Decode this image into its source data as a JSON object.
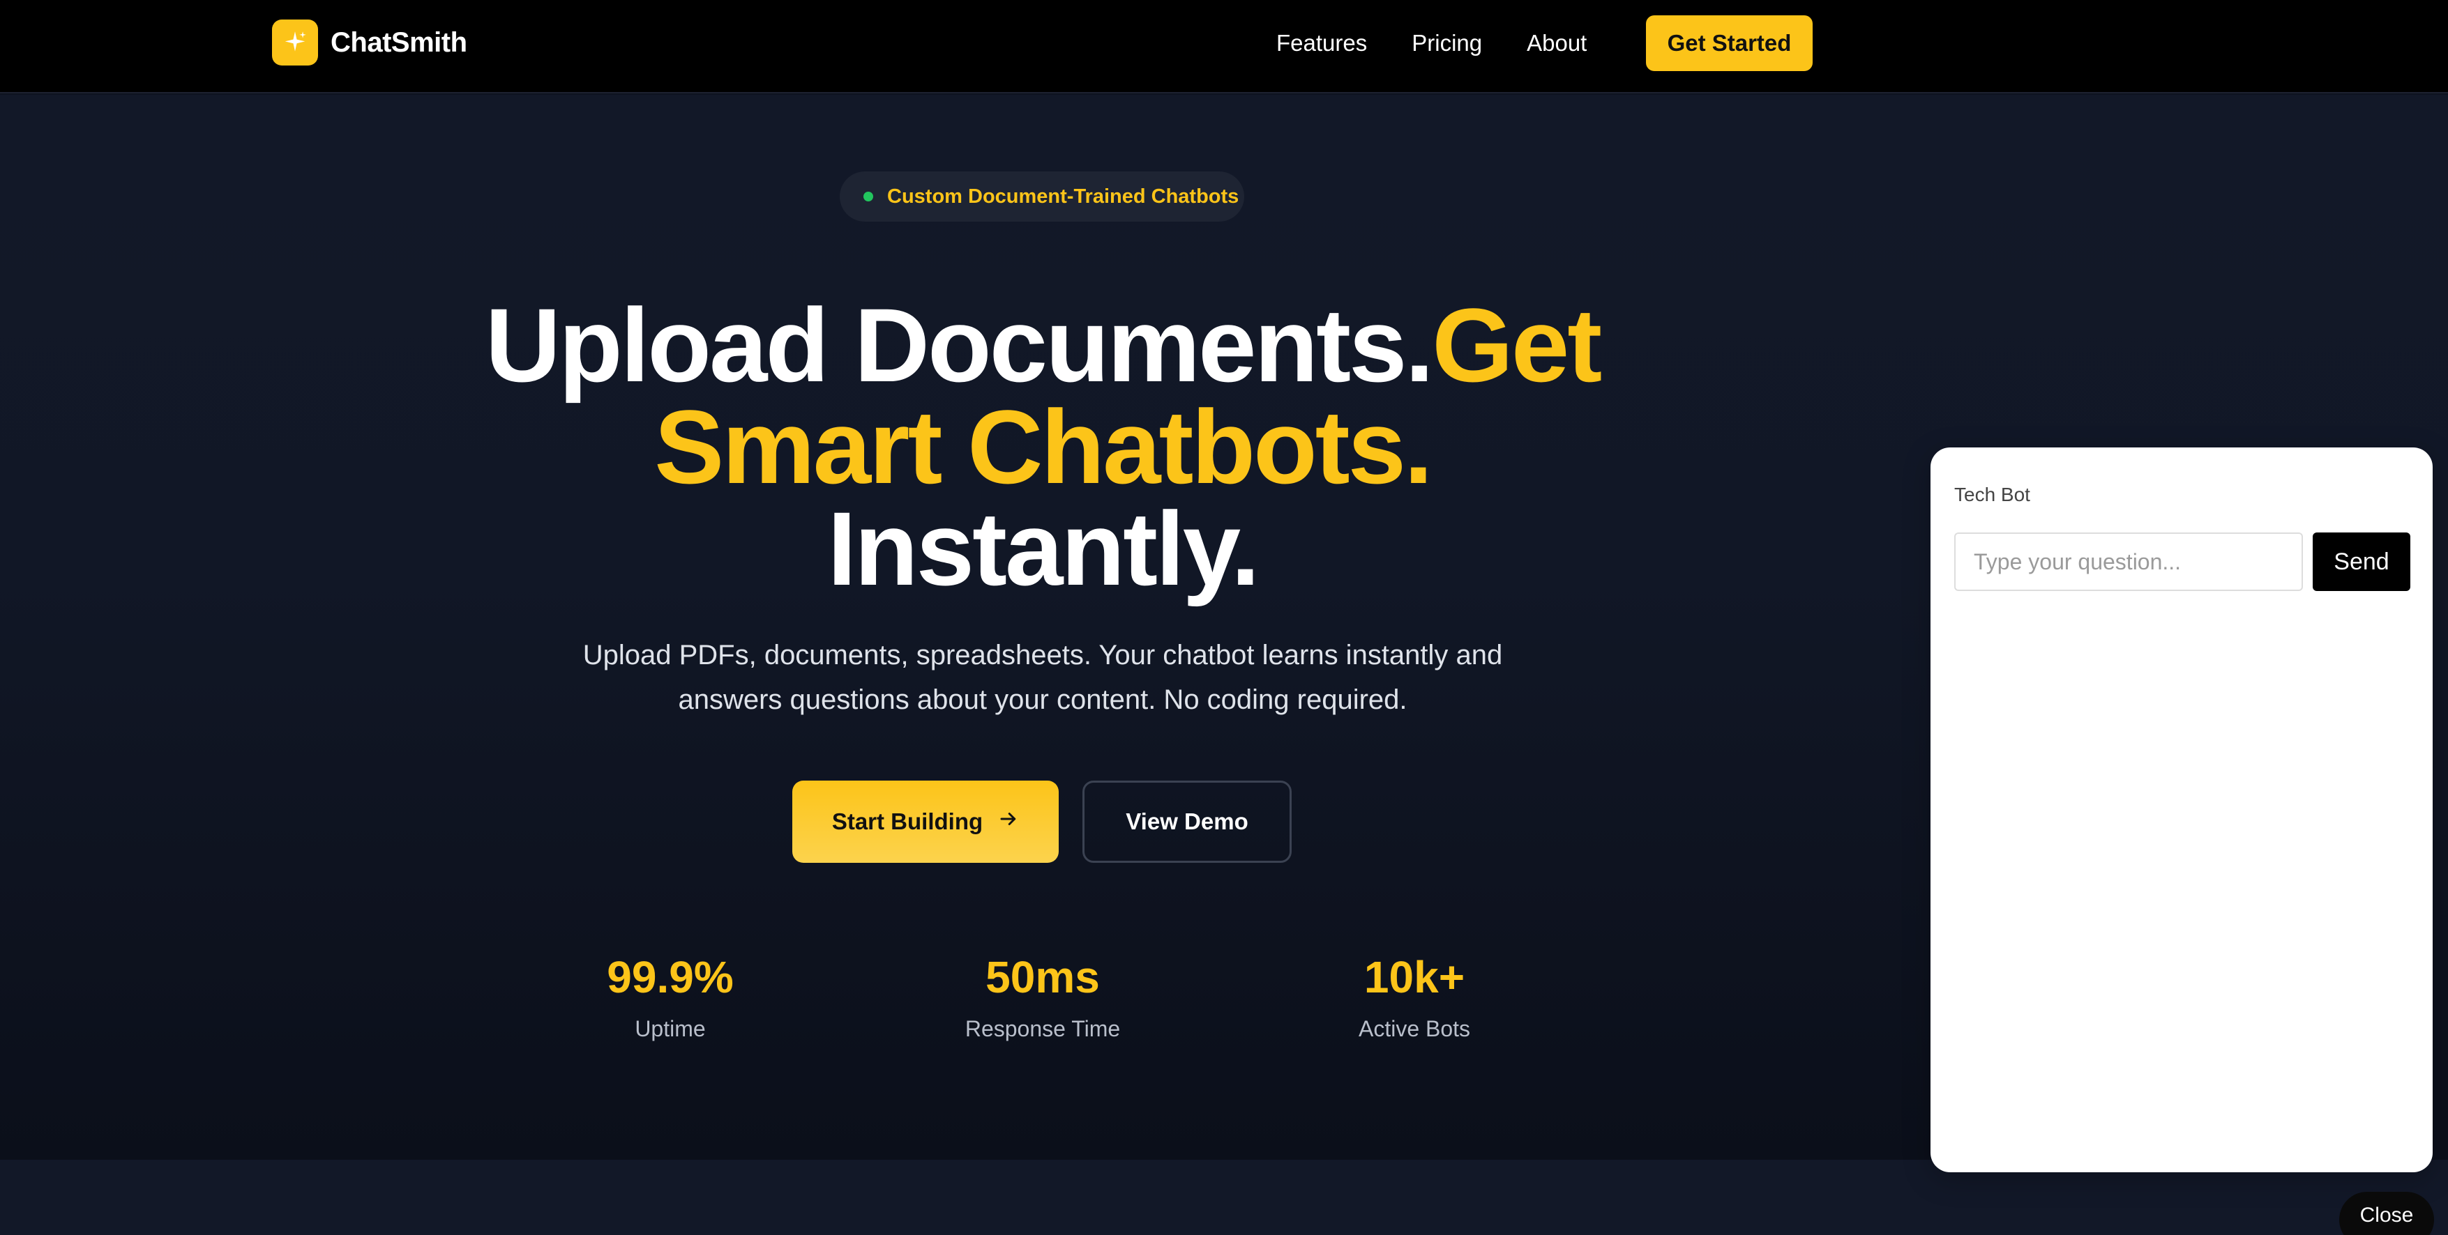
{
  "brand": {
    "name": "ChatSmith",
    "logo_icon": "sparkle-icon",
    "accent_color": "#fcc419"
  },
  "nav": {
    "links": [
      "Features",
      "Pricing",
      "About"
    ],
    "cta_label": "Get Started"
  },
  "hero": {
    "badge": "Custom Document-Trained Chatbots",
    "badge_dot_color": "#22c55e",
    "headline": {
      "part1": "Upload Documents.",
      "part2": "Get",
      "part3": "Smart Chatbots.",
      "part4": "Instantly."
    },
    "subtitle_line1": "Upload PDFs, documents, spreadsheets. Your chatbot learns instantly and",
    "subtitle_line2": "answers questions about your content. No coding required.",
    "primary_button": "Start Building",
    "primary_button_icon": "arrow-right-icon",
    "secondary_button": "View Demo"
  },
  "stats": [
    {
      "value": "99.9%",
      "label": "Uptime"
    },
    {
      "value": "50ms",
      "label": "Response Time"
    },
    {
      "value": "10k+",
      "label": "Active Bots"
    }
  ],
  "chat_widget": {
    "title": "Tech Bot",
    "input_placeholder": "Type your question...",
    "input_value": "",
    "send_label": "Send",
    "close_label": "Close"
  }
}
